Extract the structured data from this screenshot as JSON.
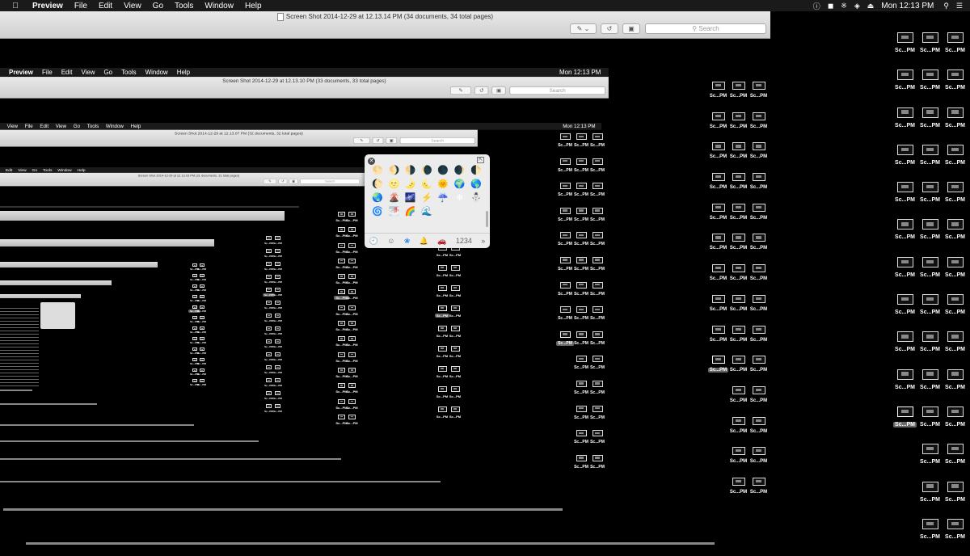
{
  "menubar": {
    "apple_icon": "apple-logo-icon",
    "app_name": "Preview",
    "items": [
      "File",
      "Edit",
      "View",
      "Go",
      "Tools",
      "Window",
      "Help"
    ],
    "status_icons": [
      "accessibility-icon",
      "volume-icon",
      "bluetooth-icon",
      "wifi-icon",
      "eject-icon"
    ],
    "clock": "Mon 12:13 PM",
    "search_icon": "spotlight-icon",
    "list_icon": "notification-center-icon"
  },
  "window": {
    "title": "Screen Shot 2014-12-29 at 12.13.14 PM (34 documents, 34 total pages)",
    "toolbar": {
      "markup_icon": "pencil-icon",
      "markup_menu_icon": "chevron-down-icon",
      "rotate_icon": "rotate-icon",
      "toolbox_icon": "toolbox-icon",
      "search_placeholder": "Search"
    }
  },
  "nested_windows": [
    {
      "title": "Screen Shot 2014-12-29 at 12.13.10 PM (33 documents, 33 total pages)",
      "clock": "Mon 12:13 PM"
    },
    {
      "title": "Screen Shot 2014-12-29 at 12.13.07 PM (32 documents, 32 total pages)",
      "clock": "Mon 12:13 PM"
    },
    {
      "title": "Screen Shot 2014-12-29 at 12.13.03 PM (31 documents, 31 total pages)",
      "clock": "Mon 12:13 PM"
    }
  ],
  "thumbnail_label": "Sc...PM",
  "thumbnail_special_label": "1,...080",
  "emoji_palette": {
    "close_icon": "close-icon",
    "expand_icon": "expand-icon",
    "emojis": [
      "🌕",
      "🌖",
      "🌗",
      "🌘",
      "🌑",
      "🌒",
      "🌓",
      "🌔",
      "🌝",
      "🌛",
      "🌜",
      "🌞",
      "🌍",
      "🌎",
      "🌏",
      "🌋",
      "🌌",
      "⚡",
      "☔",
      "❄",
      "⛄",
      "🌀",
      "🌁",
      "🌈",
      "🌊"
    ],
    "categories": [
      "🕘",
      "☺",
      "❀",
      "🔔",
      "🚗",
      "1234",
      "»"
    ]
  }
}
